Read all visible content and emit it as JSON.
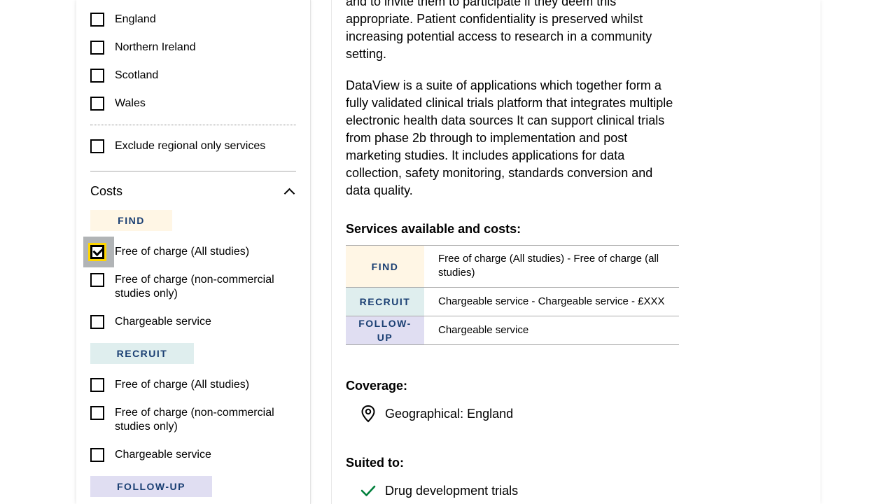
{
  "colors": {
    "find_bg": "#fff6e5",
    "recruit_bg": "#dfeeee",
    "followup_bg": "#e0def2",
    "stage_text": "#193e72",
    "focus": "#ffd600",
    "check_icon": "#007f3b"
  },
  "sidebar": {
    "regions": [
      {
        "label": "England",
        "checked": false
      },
      {
        "label": "Northern Ireland",
        "checked": false
      },
      {
        "label": "Scotland",
        "checked": false
      },
      {
        "label": "Wales",
        "checked": false
      }
    ],
    "exclude_regional": {
      "label": "Exclude regional only services",
      "checked": false
    },
    "costs_section": {
      "title": "Costs",
      "find_tag": "FIND",
      "find_options": [
        {
          "label": "Free of charge (All studies)",
          "checked": true
        },
        {
          "label": "Free of charge (non-commercial studies only)",
          "checked": false
        },
        {
          "label": "Chargeable service",
          "checked": false
        }
      ],
      "recruit_tag": "RECRUIT",
      "recruit_options": [
        {
          "label": "Free of charge (All studies)",
          "checked": false
        },
        {
          "label": "Free of charge (non-commercial studies only)",
          "checked": false
        },
        {
          "label": "Chargeable service",
          "checked": false
        }
      ],
      "followup_tag": "FOLLOW-UP"
    }
  },
  "main": {
    "intro_tail": "and to invite them to participate if they deem this appropriate. Patient confidentiality is preserved whilst increasing potential access to research in a community setting.",
    "description": "DataView is a suite of applications which together form a fully validated clinical trials platform that integrates multiple electronic health data sources It can support clinical trials from phase 2b through to implementation and post marketing studies. It includes applications for data collection, safety monitoring, standards conversion and data quality.",
    "services_heading": "Services available and costs:",
    "services": [
      {
        "stage": "FIND",
        "cost": "Free of charge (All studies) - Free of charge (all studies)"
      },
      {
        "stage": "RECRUIT",
        "cost": "Chargeable service - Chargeable service - £XXX"
      },
      {
        "stage": "FOLLOW-UP",
        "cost": "Chargeable service"
      }
    ],
    "coverage_heading": "Coverage:",
    "coverage_value": "Geographical: England",
    "suited_heading": "Suited to:",
    "suited_items": [
      "Drug development trials"
    ]
  }
}
